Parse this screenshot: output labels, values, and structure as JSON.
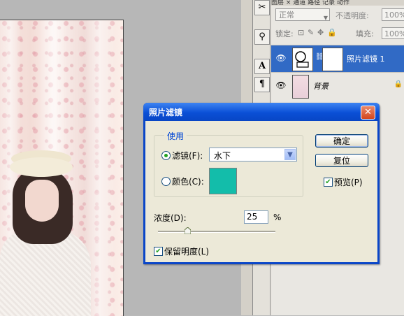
{
  "layers_panel": {
    "tabs_text": "图层 × 通道 路径 记录 动作",
    "blend_mode": "正常",
    "opacity_label": "不透明度:",
    "opacity_value": "100%",
    "lock_label": "锁定:",
    "fill_label": "填充:",
    "fill_value": "100%",
    "layers": [
      {
        "name": "照片滤镜 1",
        "selected": true
      },
      {
        "name": "背景",
        "selected": false
      }
    ]
  },
  "tools": [
    "crop-tool",
    "stamp-tool",
    "type-tool",
    "paragraph-tool"
  ],
  "dialog": {
    "title": "照片滤镜",
    "close_glyph": "✕",
    "group_legend": "使用",
    "filter_label": "滤镜(F):",
    "filter_value": "水下",
    "filter_selected": true,
    "color_label": "颜色(C):",
    "color_swatch": "#13bdaa",
    "ok_label": "确定",
    "reset_label": "复位",
    "preview_label": "预览(P)",
    "preview_checked": true,
    "density_label": "浓度(D):",
    "density_value": "25",
    "density_unit": "%",
    "density_percent": 25,
    "preserve_label": "保留明度(L)",
    "preserve_checked": true
  }
}
